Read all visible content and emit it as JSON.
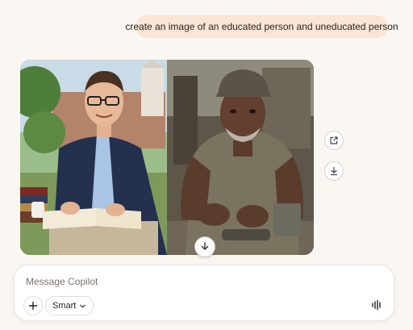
{
  "chat": {
    "user_message": "create an image of an educated person and uneducated person"
  },
  "image_actions": {
    "share_icon": "share-icon",
    "download_icon": "download-icon"
  },
  "composer": {
    "placeholder": "Message Copilot",
    "mode_label": "Smart",
    "add_icon": "plus-icon",
    "voice_icon": "voice-waveform-icon"
  },
  "colors": {
    "background": "#faf6f1",
    "user_bubble": "#f9e6d4"
  }
}
